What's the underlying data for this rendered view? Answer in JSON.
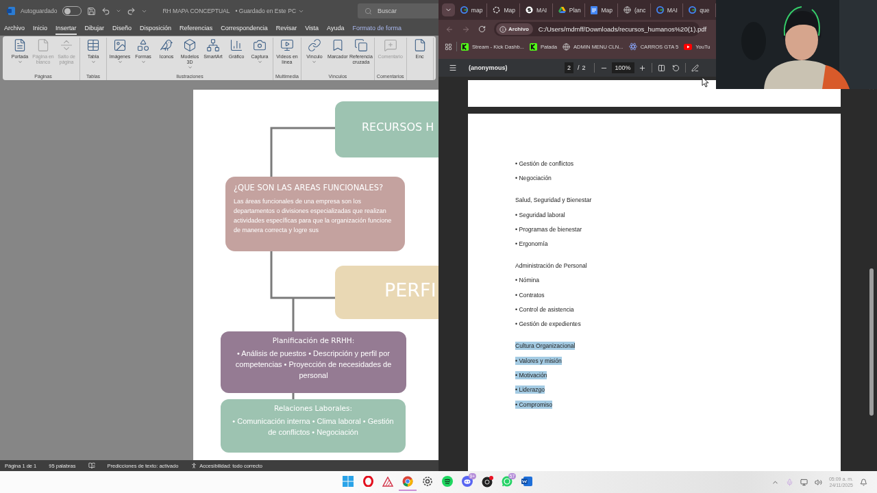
{
  "word": {
    "autosave": {
      "label": "Autoguardado",
      "on": false
    },
    "title": "RH MAPA CONCEPTUAL",
    "save_status": "• Guardado en Este PC",
    "search": {
      "placeholder": "Buscar"
    },
    "menu_tabs": [
      {
        "label": "Archivo",
        "selected": false,
        "kind": "standard"
      },
      {
        "label": "Inicio",
        "selected": false,
        "kind": "standard"
      },
      {
        "label": "Insertar",
        "selected": true,
        "kind": "standard"
      },
      {
        "label": "Dibujar",
        "selected": false,
        "kind": "standard"
      },
      {
        "label": "Diseño",
        "selected": false,
        "kind": "standard"
      },
      {
        "label": "Disposición",
        "selected": false,
        "kind": "standard"
      },
      {
        "label": "Referencias",
        "selected": false,
        "kind": "standard"
      },
      {
        "label": "Correspondencia",
        "selected": false,
        "kind": "standard"
      },
      {
        "label": "Revisar",
        "selected": false,
        "kind": "standard"
      },
      {
        "label": "Vista",
        "selected": false,
        "kind": "standard"
      },
      {
        "label": "Ayuda",
        "selected": false,
        "kind": "standard"
      },
      {
        "label": "Formato de forma",
        "selected": false,
        "kind": "contextual"
      }
    ],
    "ribbon_groups": [
      {
        "label": "Páginas",
        "items": [
          {
            "label": "Portada",
            "disabled": false,
            "menu": true
          },
          {
            "label": "Página en blanco",
            "disabled": true,
            "menu": false
          },
          {
            "label": "Salto de página",
            "disabled": true,
            "menu": false
          }
        ]
      },
      {
        "label": "Tablas",
        "items": [
          {
            "label": "Tabla",
            "disabled": false,
            "menu": true
          }
        ]
      },
      {
        "label": "Ilustraciones",
        "items": [
          {
            "label": "Imágenes",
            "disabled": false,
            "menu": true
          },
          {
            "label": "Formas",
            "disabled": false,
            "menu": true
          },
          {
            "label": "Iconos",
            "disabled": false,
            "menu": false
          },
          {
            "label": "Modelos 3D",
            "disabled": false,
            "menu": true
          },
          {
            "label": "SmartArt",
            "disabled": false,
            "menu": false
          },
          {
            "label": "Gráfico",
            "disabled": false,
            "menu": false
          },
          {
            "label": "Captura",
            "disabled": false,
            "menu": true
          }
        ]
      },
      {
        "label": "Multimedia",
        "items": [
          {
            "label": "Vídeos en línea",
            "disabled": false,
            "menu": false
          }
        ]
      },
      {
        "label": "Vínculos",
        "items": [
          {
            "label": "Vínculo",
            "disabled": false,
            "menu": true
          },
          {
            "label": "Marcador",
            "disabled": false,
            "menu": false
          },
          {
            "label": "Referencia cruzada",
            "disabled": false,
            "menu": false
          }
        ]
      },
      {
        "label": "Comentarios",
        "items": [
          {
            "label": "Comentario",
            "disabled": true,
            "menu": false
          }
        ]
      },
      {
        "items": [
          {
            "label": "Enc",
            "disabled": false,
            "menu": false
          }
        ]
      }
    ],
    "diagram": {
      "nodes": [
        {
          "kind": "heading",
          "title": "RECURSOS H",
          "color": "#9dc3b1"
        },
        {
          "kind": "definition",
          "title": "¿QUE SON LAS AREAS FUNCIONALES?",
          "body": "Las áreas funcionales de una empresa son los departamentos o divisiones especializadas que realizan actividades específicas para que la organización funcione de manera correcta y logre sus",
          "color": "#c4a29f"
        },
        {
          "kind": "heading",
          "title": "PERFI",
          "color": "#e9d8b4"
        },
        {
          "kind": "list",
          "title": "Planificación de RRHH:",
          "body": "• Análisis de puestos • Descripción y perfil por competencias • Proyección de necesidades de personal",
          "color": "#957b93"
        },
        {
          "kind": "list",
          "title": "Relaciones Laborales:",
          "body": "• Comunicación interna • Clima laboral • Gestión de conflictos • Negociación",
          "color": "#9dc3b1"
        }
      ]
    },
    "status_bar": {
      "page": "Página 1 de 1",
      "words": "95 palabras",
      "predictions": "Predicciones de texto: activado",
      "accessibility": "Accesibilidad: todo correcto"
    }
  },
  "browser": {
    "tabs": [
      {
        "label": "map",
        "kind": "google"
      },
      {
        "label": "Map",
        "kind": "spiral"
      },
      {
        "label": "MAI",
        "kind": "s"
      },
      {
        "label": "Plan",
        "kind": "drive"
      },
      {
        "label": "Map",
        "kind": "docs"
      },
      {
        "label": "(anc",
        "kind": "globe"
      },
      {
        "label": "MAI",
        "kind": "google"
      },
      {
        "label": "que",
        "kind": "google"
      }
    ],
    "site_chip": "Archivo",
    "url": "C:/Users/mdmff/Downloads/recursos_humanos%20(1).pdf",
    "bookmarks": [
      {
        "label": "Stream - Kick Dashb...",
        "kind": "kick"
      },
      {
        "label": "Patada",
        "kind": "kick"
      },
      {
        "label": "ADMIN MENU CLN...",
        "kind": "globe"
      },
      {
        "label": "CARROS GTA 5",
        "kind": "atom"
      },
      {
        "label": "YouTu",
        "kind": "youtube"
      }
    ],
    "pdf": {
      "title": "(anonymous)",
      "page": "2",
      "page_separator": "/",
      "page_count": "2",
      "zoom": "100%",
      "lines": [
        {
          "text": "• Gestión de conflictos",
          "kind": "bullet",
          "highlighted": false
        },
        {
          "text": "• Negociación",
          "kind": "bullet",
          "highlighted": false
        },
        {
          "text": "Salud, Seguridad y Bienestar",
          "kind": "heading",
          "highlighted": false
        },
        {
          "text": "• Seguridad laboral",
          "kind": "bullet",
          "highlighted": false
        },
        {
          "text": "• Programas de bienestar",
          "kind": "bullet",
          "highlighted": false
        },
        {
          "text": "• Ergonomía",
          "kind": "bullet",
          "highlighted": false
        },
        {
          "text": "Administración de Personal",
          "kind": "heading",
          "highlighted": false
        },
        {
          "text": "• Nómina",
          "kind": "bullet",
          "highlighted": false
        },
        {
          "text": "• Contratos",
          "kind": "bullet",
          "highlighted": false
        },
        {
          "text": "• Control de asistencia",
          "kind": "bullet",
          "highlighted": false
        },
        {
          "text": "• Gestión de expedientes",
          "kind": "bullet",
          "highlighted": false
        },
        {
          "text": "Cultura Organizacional",
          "kind": "heading",
          "highlighted": true
        },
        {
          "text": "• Valores y misión",
          "kind": "bullet",
          "highlighted": true
        },
        {
          "text": "• Motivación",
          "kind": "bullet",
          "highlighted": true
        },
        {
          "text": "• Liderazgo",
          "kind": "bullet",
          "highlighted": true
        },
        {
          "text": "• Compromiso",
          "kind": "bullet",
          "highlighted": true
        }
      ]
    }
  },
  "taskbar": {
    "apps": [
      {
        "kind": "start",
        "running": false
      },
      {
        "kind": "opera",
        "running": false
      },
      {
        "kind": "affinity",
        "running": false
      },
      {
        "kind": "chrome",
        "running": true
      },
      {
        "kind": "steam",
        "running": false
      },
      {
        "kind": "spotify",
        "running": false
      },
      {
        "kind": "discord",
        "running": false,
        "badge": "9+"
      },
      {
        "kind": "obs",
        "running": false
      },
      {
        "kind": "whatsapp",
        "running": false,
        "badge": "57"
      },
      {
        "kind": "word",
        "running": false
      }
    ],
    "clock": {
      "time": "05:09 a. m.",
      "date": "24/11/2025"
    }
  }
}
